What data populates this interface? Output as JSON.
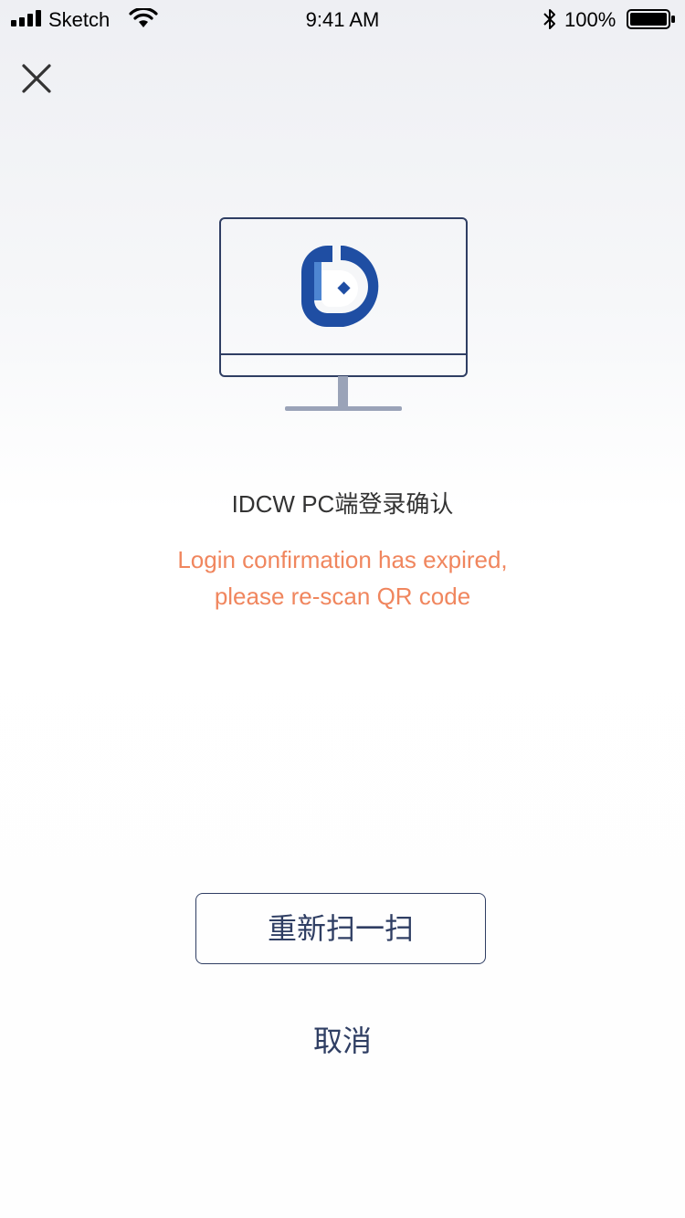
{
  "status_bar": {
    "carrier": "Sketch",
    "time": "9:41 AM",
    "battery_percent": "100%",
    "icons": [
      "signal-icon",
      "wifi-icon",
      "bluetooth-icon",
      "battery-icon"
    ]
  },
  "header": {
    "close_icon": "close-icon"
  },
  "illustration": {
    "name": "monitor-illustration",
    "logo": "idcw-logo-icon"
  },
  "main": {
    "title": "IDCW PC端登录确认",
    "message_line1": "Login confirmation has expired,",
    "message_line2": "please re-scan QR code"
  },
  "actions": {
    "rescan_label": "重新扫一扫",
    "cancel_label": "取消"
  },
  "colors": {
    "accent": "#2f3e63",
    "warning": "#f0865e",
    "logo_blue": "#1f4ea3",
    "title_text": "#333333"
  }
}
